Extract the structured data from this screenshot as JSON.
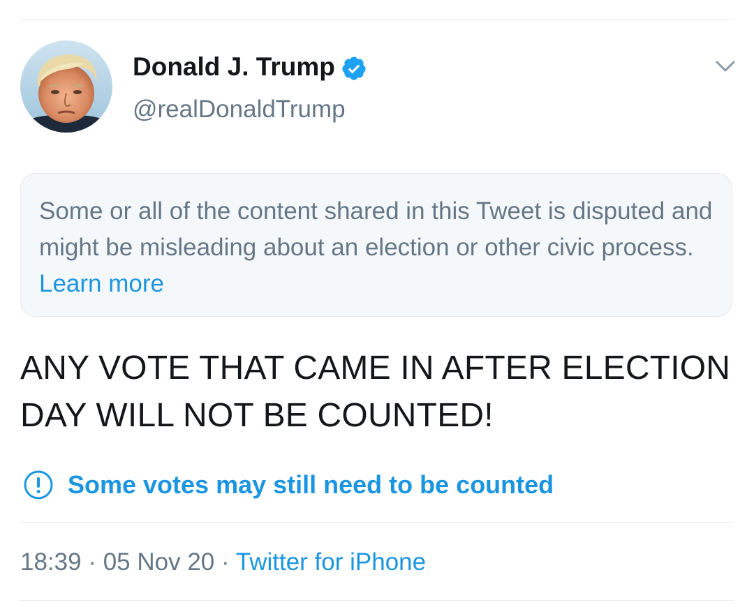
{
  "author": {
    "display_name": "Donald J. Trump",
    "handle": "@realDonaldTrump",
    "verified": true,
    "avatar_icon": "profile-photo",
    "verified_icon": "verified-badge-icon"
  },
  "notice": {
    "text": "Some or all of the content shared in this Tweet is disputed and might be misleading about an election or other civic process. ",
    "link_label": "Learn more"
  },
  "tweet": {
    "text": "ANY VOTE THAT CAME IN AFTER ELECTION DAY WILL NOT BE COUNTED!"
  },
  "label": {
    "icon": "exclamation-circle-icon",
    "text": "Some votes may still need to be counted"
  },
  "meta": {
    "time": "18:39",
    "date": "05 Nov 20",
    "separator": " · ",
    "source": "Twitter for iPhone"
  },
  "colors": {
    "accent": "#1b95e0",
    "text_primary": "#14171a",
    "text_secondary": "#657786",
    "notice_background": "#f5f8fa"
  }
}
